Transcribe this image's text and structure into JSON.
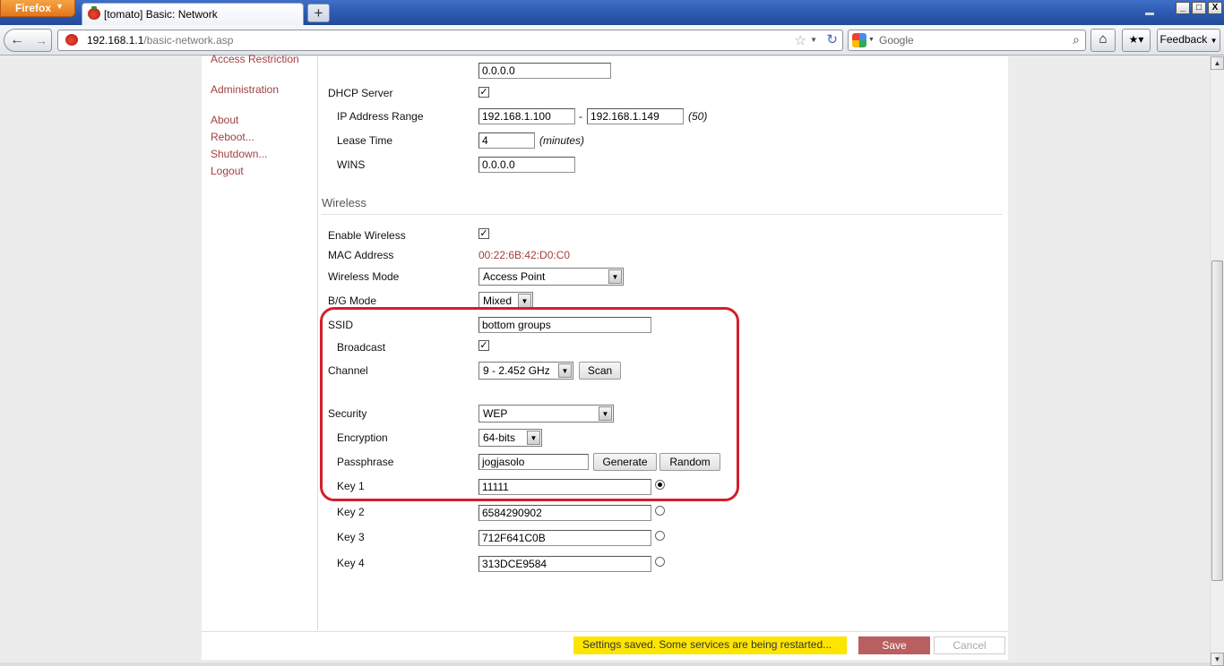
{
  "browser": {
    "app_button": "Firefox",
    "tab_title": "[tomato] Basic: Network",
    "new_tab": "+",
    "url_host": "192.168.1.1",
    "url_path": "/basic-network.asp",
    "search_placeholder": "Google",
    "feedback_label": "Feedback",
    "window_min": "_",
    "window_max": "□",
    "window_close": "X"
  },
  "sidebar": {
    "items": [
      {
        "label": "Access Restriction"
      },
      {
        "label": "Administration"
      },
      {
        "label": "About"
      },
      {
        "label": "Reboot..."
      },
      {
        "label": "Shutdown..."
      },
      {
        "label": "Logout"
      }
    ]
  },
  "lan": {
    "top_field": "0.0.0.0",
    "dhcp_server_label": "DHCP Server",
    "dhcp_server_checked": true,
    "ip_range_label": "IP Address Range",
    "ip_range_start": "192.168.1.100",
    "ip_range_sep": "-",
    "ip_range_end": "192.168.1.149",
    "ip_range_count": "(50)",
    "lease_label": "Lease Time",
    "lease_value": "4",
    "lease_unit": "(minutes)",
    "wins_label": "WINS",
    "wins_value": "0.0.0.0"
  },
  "wireless": {
    "section_title": "Wireless",
    "enable_label": "Enable Wireless",
    "enable_checked": true,
    "mac_label": "MAC Address",
    "mac_value": "00:22:6B:42:D0:C0",
    "mode_label": "Wireless Mode",
    "mode_value": "Access Point",
    "bg_label": "B/G Mode",
    "bg_value": "Mixed",
    "ssid_label": "SSID",
    "ssid_value": "bottom groups",
    "broadcast_label": "Broadcast",
    "broadcast_checked": true,
    "channel_label": "Channel",
    "channel_value": "9 - 2.452 GHz",
    "scan_label": "Scan",
    "security_label": "Security",
    "security_value": "WEP",
    "encryption_label": "Encryption",
    "encryption_value": "64-bits",
    "passphrase_label": "Passphrase",
    "passphrase_value": "jogjasolo",
    "generate_label": "Generate",
    "random_label": "Random",
    "keys": [
      {
        "label": "Key 1",
        "value": "11111",
        "selected": true
      },
      {
        "label": "Key 2",
        "value": "6584290902",
        "selected": false
      },
      {
        "label": "Key 3",
        "value": "712F641C0B",
        "selected": false
      },
      {
        "label": "Key 4",
        "value": "313DCE9584",
        "selected": false
      }
    ]
  },
  "footer": {
    "status": "Settings saved. Some services are being restarted...",
    "save_label": "Save",
    "cancel_label": "Cancel"
  },
  "colors": {
    "link": "#a14040",
    "highlight": "#d21f2d",
    "status_bg": "#fde500",
    "save_bg": "#b95f5f"
  }
}
